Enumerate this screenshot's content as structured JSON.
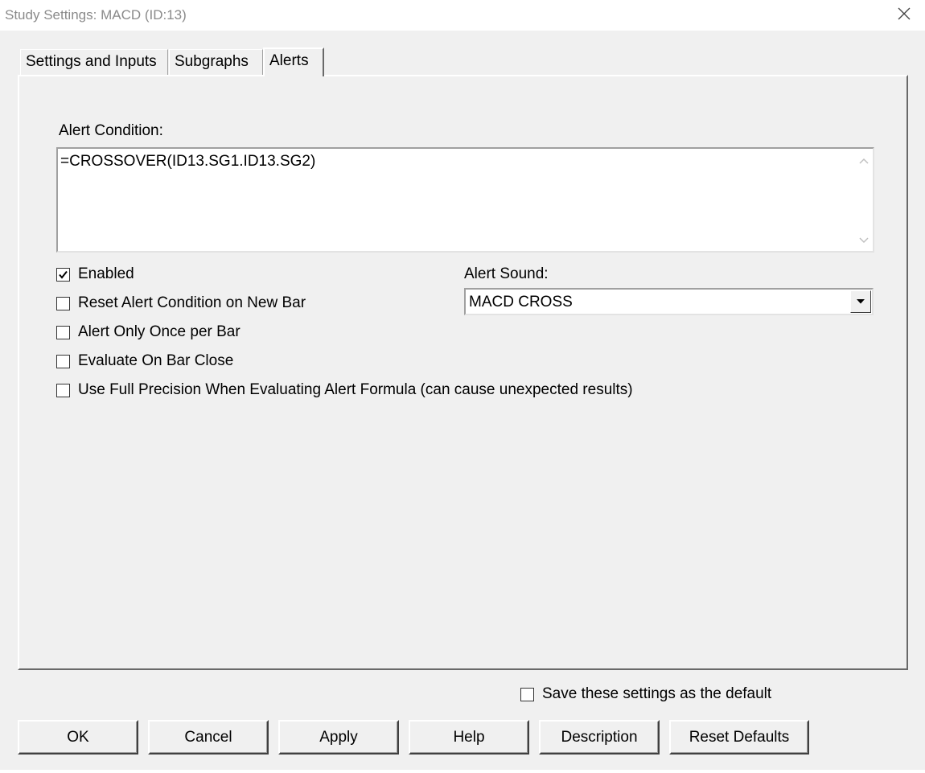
{
  "window": {
    "title": "Study Settings: MACD (ID:13)",
    "close_icon": "close-icon"
  },
  "tabs": [
    {
      "label": "Settings and Inputs",
      "active": false
    },
    {
      "label": "Subgraphs",
      "active": false
    },
    {
      "label": "Alerts",
      "active": true
    }
  ],
  "alerts": {
    "condition_label": "Alert Condition:",
    "condition_value": "=CROSSOVER(ID13.SG1.ID13.SG2)",
    "checkboxes": [
      {
        "label": "Enabled",
        "checked": true
      },
      {
        "label": "Reset Alert Condition on New Bar",
        "checked": false
      },
      {
        "label": "Alert Only Once per Bar",
        "checked": false
      },
      {
        "label": "Evaluate On Bar Close",
        "checked": false
      },
      {
        "label": "Use Full Precision When Evaluating Alert Formula (can cause unexpected results)",
        "checked": false
      }
    ],
    "sound_label": "Alert Sound:",
    "sound_value": "MACD CROSS"
  },
  "footer": {
    "save_default": {
      "label": "Save these settings as the default",
      "checked": false
    },
    "buttons": {
      "ok": "OK",
      "cancel": "Cancel",
      "apply": "Apply",
      "help": "Help",
      "description": "Description",
      "reset_defaults": "Reset Defaults"
    }
  }
}
